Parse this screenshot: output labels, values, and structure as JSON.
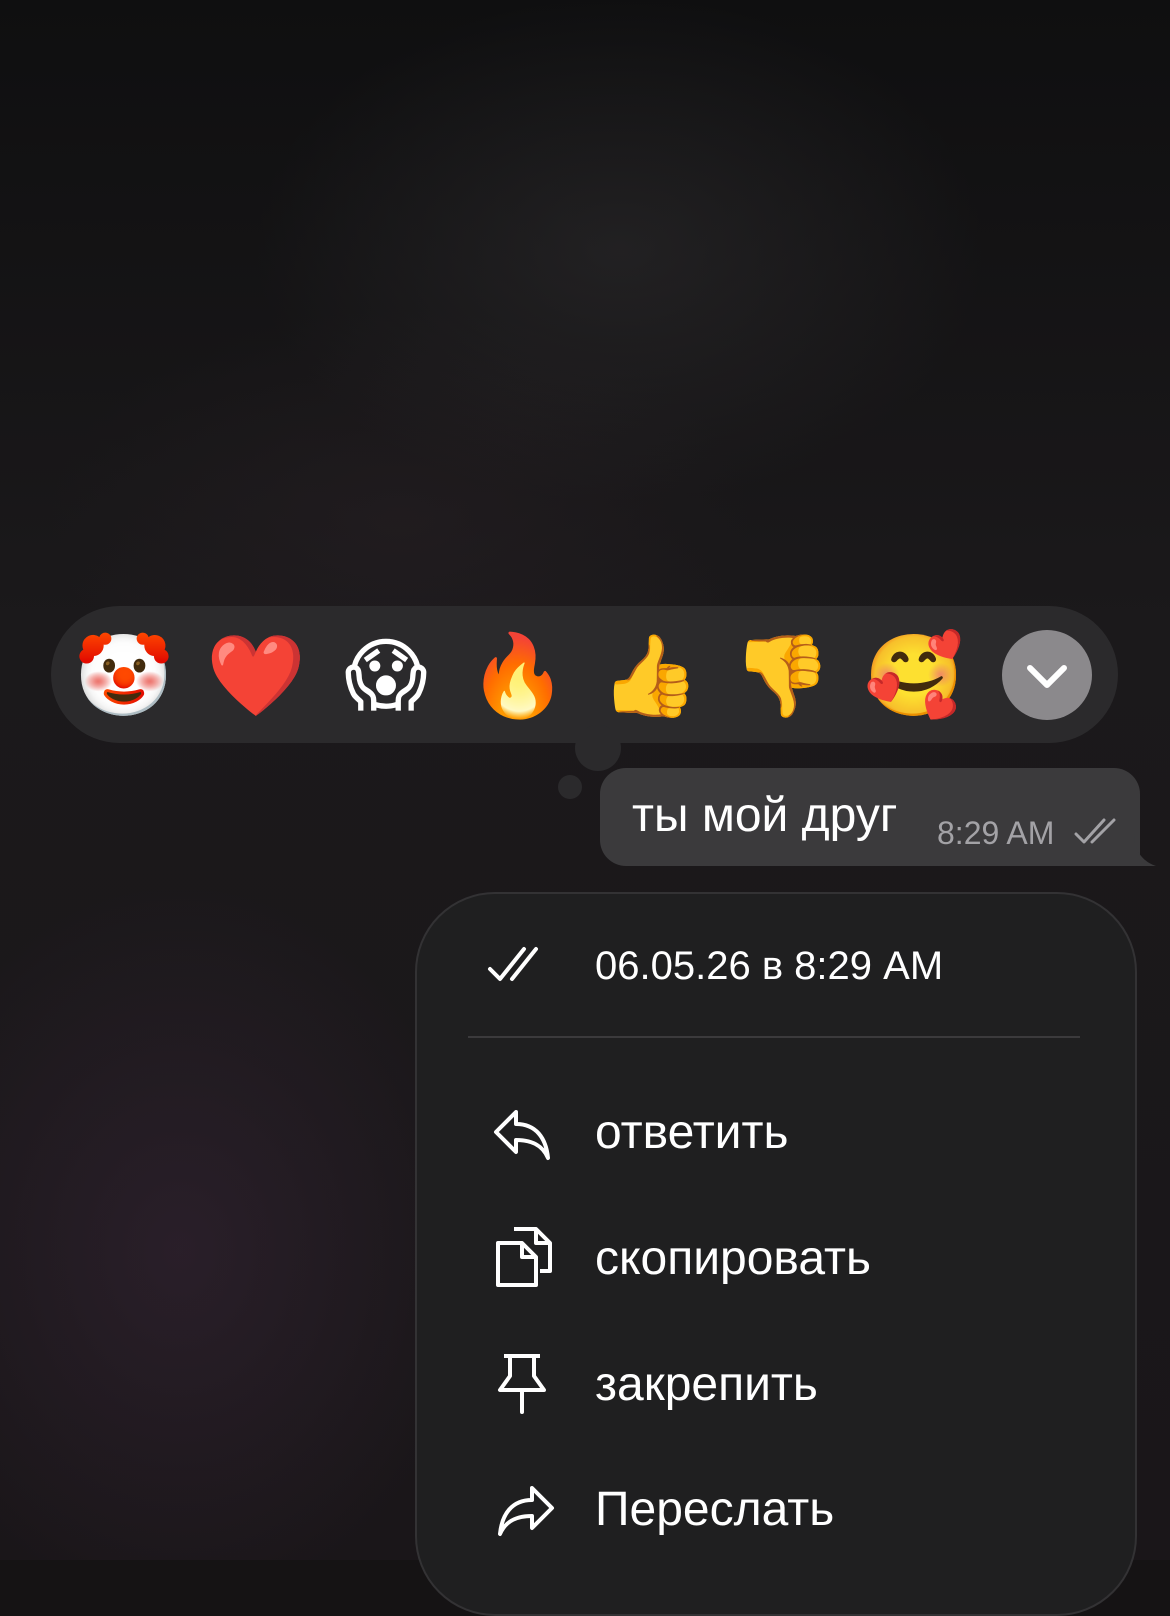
{
  "reactions": {
    "emojis": [
      "🤡",
      "❤️",
      "😱",
      "🔥",
      "👍",
      "👎",
      "🥰"
    ],
    "expand_icon": "chevron-down-icon"
  },
  "message": {
    "text": "ты мой друг",
    "time": "8:29 AM",
    "status_icon": "double-check-icon"
  },
  "menu": {
    "date_text": "06.05.26 в 8:29 AM",
    "items": [
      {
        "label": "ответить",
        "icon": "reply-icon"
      },
      {
        "label": "скопировать",
        "icon": "copy-icon"
      },
      {
        "label": "закрепить",
        "icon": "pin-icon"
      },
      {
        "label": "Переслать",
        "icon": "forward-icon"
      }
    ]
  },
  "colors": {
    "panel": "#2b2a2c",
    "bubble": "#3b3a3c",
    "menu": "#1f1f20",
    "muted_text": "#a3a2a6"
  }
}
